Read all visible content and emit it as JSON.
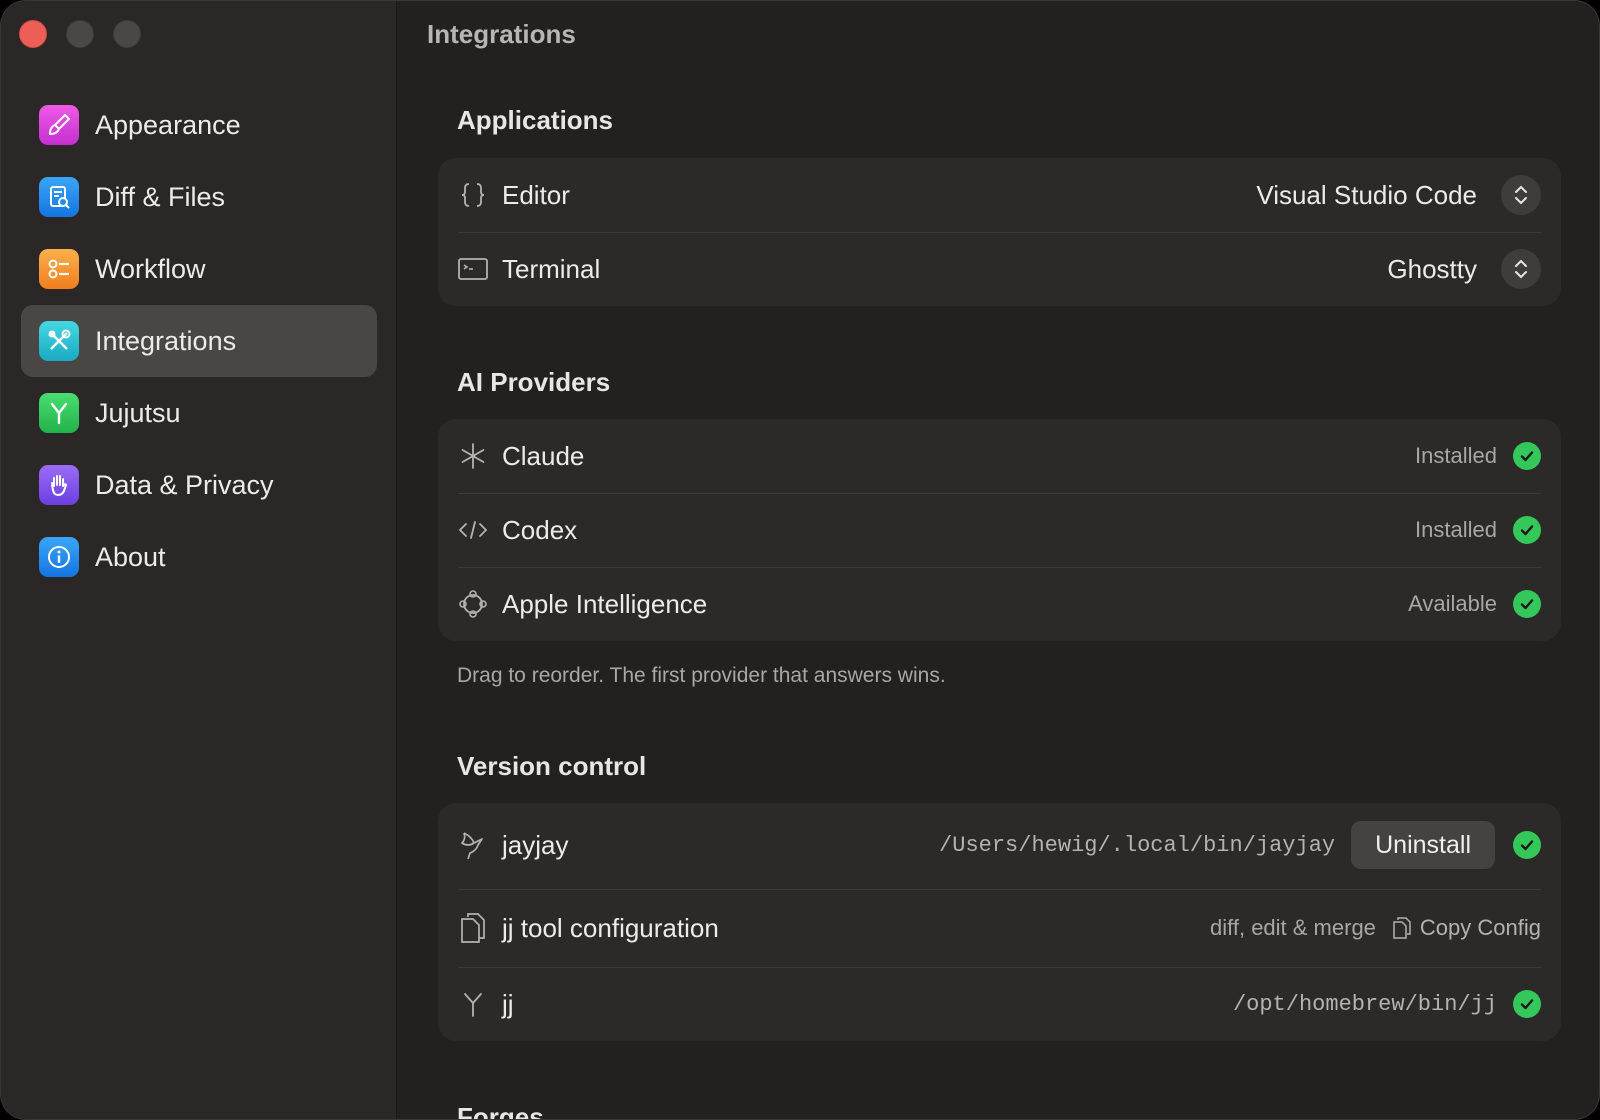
{
  "window": {
    "title": "Integrations"
  },
  "sidebar": {
    "items": [
      {
        "label": "Appearance",
        "icon": "paintbrush-icon",
        "color": "#e03fd8"
      },
      {
        "label": "Diff & Files",
        "icon": "document-search-icon",
        "color": "#1e90f0"
      },
      {
        "label": "Workflow",
        "icon": "checklist-icon",
        "color": "#f59a2f"
      },
      {
        "label": "Integrations",
        "icon": "tools-icon",
        "color": "#2bc4d2"
      },
      {
        "label": "Jujutsu",
        "icon": "branch-icon",
        "color": "#2ec95c"
      },
      {
        "label": "Data & Privacy",
        "icon": "hand-icon",
        "color": "#8757f0"
      },
      {
        "label": "About",
        "icon": "info-icon",
        "color": "#1e90f0"
      }
    ],
    "active": "Integrations"
  },
  "applications": {
    "title": "Applications",
    "editor": {
      "label": "Editor",
      "value": "Visual Studio Code"
    },
    "terminal": {
      "label": "Terminal",
      "value": "Ghostty"
    }
  },
  "ai_providers": {
    "title": "AI Providers",
    "items": [
      {
        "label": "Claude",
        "status": "Installed"
      },
      {
        "label": "Codex",
        "status": "Installed"
      },
      {
        "label": "Apple Intelligence",
        "status": "Available"
      }
    ],
    "hint": "Drag to reorder. The first provider that answers wins."
  },
  "version_control": {
    "title": "Version control",
    "jayjay": {
      "label": "jayjay",
      "path": "/Users/hewig/.local/bin/jayjay",
      "button": "Uninstall"
    },
    "jj_tool": {
      "label": "jj tool configuration",
      "detail": "diff, edit & merge",
      "copy": "Copy Config"
    },
    "jj": {
      "label": "jj",
      "path": "/opt/homebrew/bin/jj"
    }
  },
  "forges": {
    "title": "Forges"
  },
  "colors": {
    "success": "#34c759",
    "close": "#ed5f56"
  }
}
